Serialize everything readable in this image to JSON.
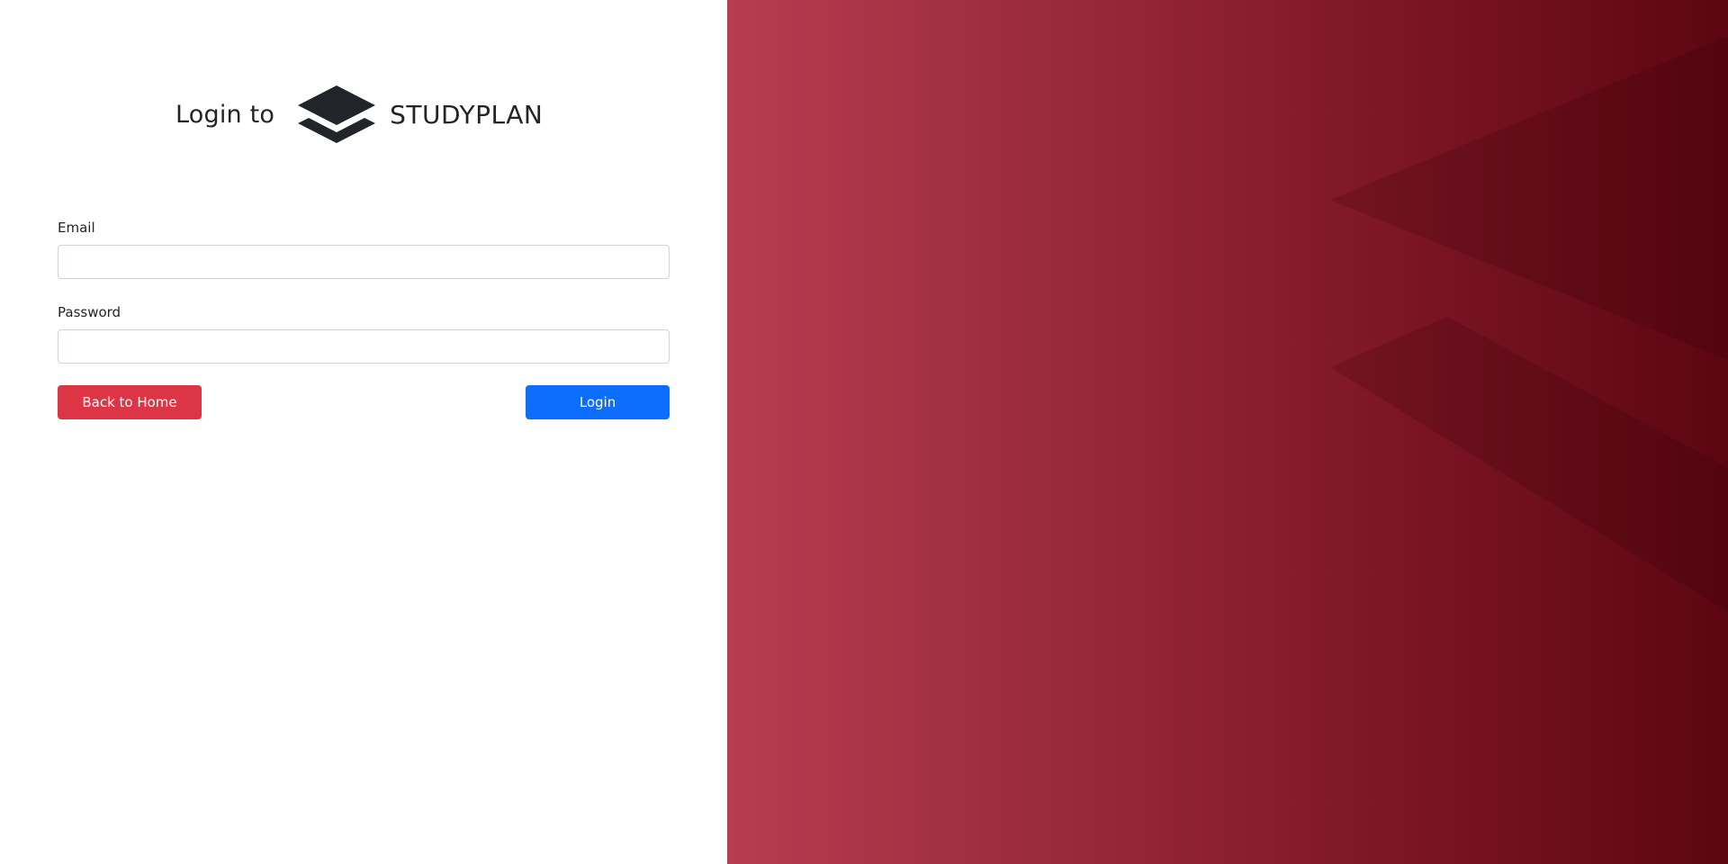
{
  "header": {
    "login_to": "Login to",
    "brand_name": "STUDYPLAN",
    "logo_icon": "stacked-layers-icon"
  },
  "form": {
    "email_label": "Email",
    "email_value": "",
    "email_placeholder": "",
    "password_label": "Password",
    "password_value": "",
    "password_placeholder": ""
  },
  "actions": {
    "back_label": "Back to Home",
    "login_label": "Login"
  },
  "colors": {
    "back_button": "#dc3545",
    "login_button": "#0d6efd",
    "gradient_start": "#b73c50",
    "gradient_end": "#5c0611"
  }
}
